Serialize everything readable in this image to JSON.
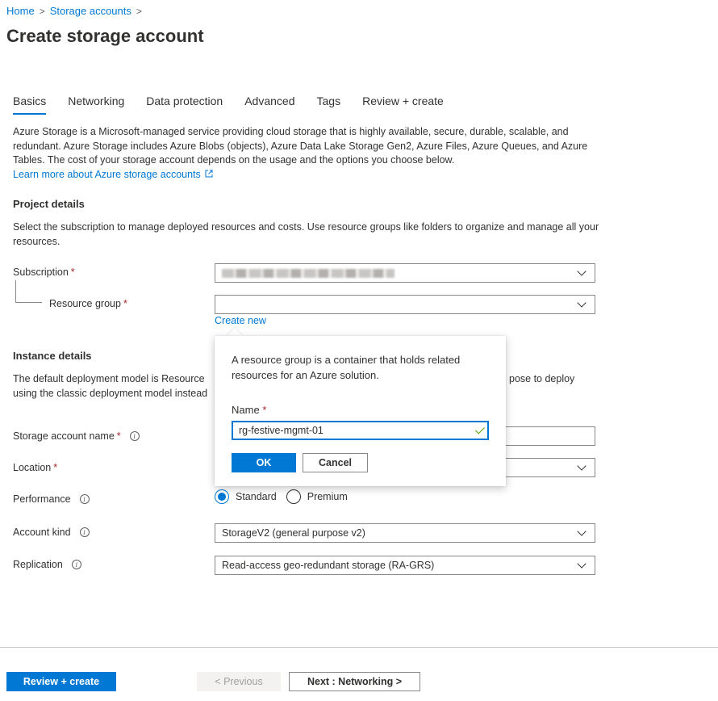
{
  "breadcrumb": {
    "home": "Home",
    "storage": "Storage accounts",
    "sep": ">"
  },
  "page_title": "Create storage account",
  "tabs": [
    "Basics",
    "Networking",
    "Data protection",
    "Advanced",
    "Tags",
    "Review + create"
  ],
  "intro": {
    "text": "Azure Storage is a Microsoft-managed service providing cloud storage that is highly available, secure, durable, scalable, and redundant. Azure Storage includes Azure Blobs (objects), Azure Data Lake Storage Gen2, Azure Files, Azure Queues, and Azure Tables. The cost of your storage account depends on the usage and the options you choose below.",
    "link": "Learn more about Azure storage accounts"
  },
  "project": {
    "heading": "Project details",
    "desc": "Select the subscription to manage deployed resources and costs. Use resource groups like folders to organize and manage all your resources.",
    "subscription_label": "Subscription",
    "resource_group_label": "Resource group",
    "resource_group_value": "",
    "create_new": "Create new"
  },
  "instance": {
    "heading": "Instance details",
    "desc_left": "The default deployment model is Resource",
    "desc_left2": "using the classic deployment model instead",
    "desc_right": "pose to deploy",
    "storage_name_label": "Storage account name",
    "location_label": "Location",
    "performance_label": "Performance",
    "performance_options": [
      "Standard",
      "Premium"
    ],
    "performance_selected": "Standard",
    "account_kind_label": "Account kind",
    "account_kind_value": "StorageV2 (general purpose v2)",
    "replication_label": "Replication",
    "replication_value": "Read-access geo-redundant storage (RA-GRS)"
  },
  "popup": {
    "text": "A resource group is a container that holds related resources for an Azure solution.",
    "name_label": "Name",
    "name_value": "rg-festive-mgmt-01",
    "ok": "OK",
    "cancel": "Cancel"
  },
  "footer": {
    "review": "Review + create",
    "previous": "< Previous",
    "next": "Next : Networking >"
  },
  "required_mark": "*",
  "info_mark": "i",
  "colors": {
    "accent": "#0078d4",
    "required": "#a4262c",
    "valid": "#57a300"
  }
}
